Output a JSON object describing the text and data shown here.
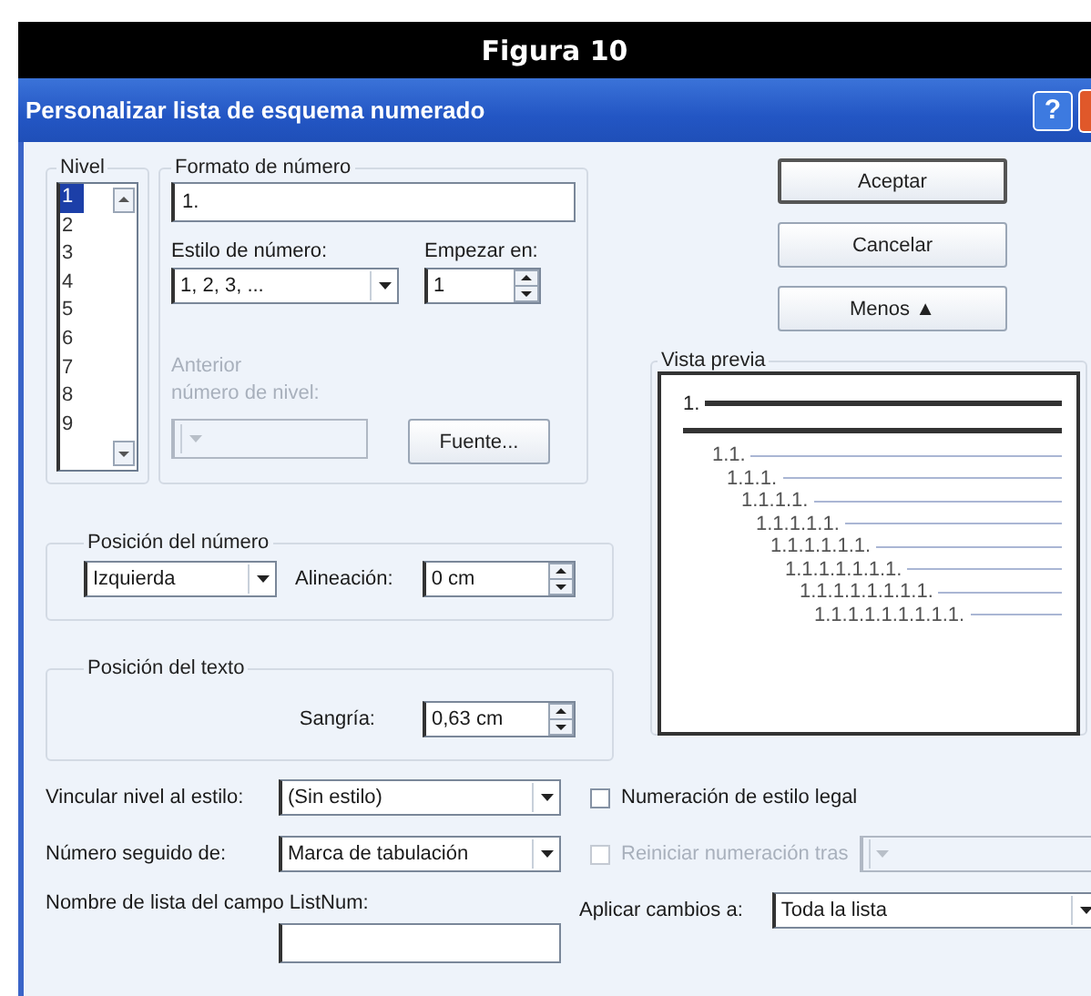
{
  "figure_caption": "Figura 10",
  "window": {
    "title": "Personalizar lista de esquema numerado",
    "help_button": "?"
  },
  "level": {
    "label": "Nivel",
    "items": [
      {
        "label": "1",
        "selected": true
      },
      {
        "label": "2",
        "selected": false
      },
      {
        "label": "3",
        "selected": false
      },
      {
        "label": "4",
        "selected": false
      },
      {
        "label": "5",
        "selected": false
      },
      {
        "label": "6",
        "selected": false
      },
      {
        "label": "7",
        "selected": false
      },
      {
        "label": "8",
        "selected": false
      },
      {
        "label": "9",
        "selected": false
      }
    ]
  },
  "number_format": {
    "label": "Formato de número",
    "value": "1.",
    "style_label": "Estilo de número:",
    "style_value": "1, 2, 3, ...",
    "start_label": "Empezar en:",
    "start_value": "1",
    "previous_label_1": "Anterior",
    "previous_label_2": "número de nivel:",
    "previous_disabled": true,
    "font_button": "Fuente..."
  },
  "buttons": [
    {
      "label": "Aceptar",
      "default": true
    },
    {
      "label": "Cancelar",
      "default": false
    },
    {
      "label": "Menos ▲",
      "default": false
    }
  ],
  "preview": {
    "label": "Vista previa",
    "lines": [
      {
        "kind": "main",
        "label": "1."
      },
      {
        "kind": "continuation"
      },
      {
        "kind": "sub",
        "label": "1.1."
      },
      {
        "kind": "sub",
        "label": "1.1.1."
      },
      {
        "kind": "sub",
        "label": "1.1.1.1."
      },
      {
        "kind": "sub",
        "label": "1.1.1.1.1."
      },
      {
        "kind": "sub",
        "label": "1.1.1.1.1.1."
      },
      {
        "kind": "sub",
        "label": "1.1.1.1.1.1.1."
      },
      {
        "kind": "sub",
        "label": "1.1.1.1.1.1.1.1."
      },
      {
        "kind": "sub",
        "label": "1.1.1.1.1.1.1.1.1."
      }
    ]
  },
  "number_position": {
    "label": "Posición del número",
    "alignment_value": "Izquierda",
    "offset_label": "Alineación:",
    "offset_value": "0 cm"
  },
  "text_position": {
    "label": "Posición del texto",
    "indent_label": "Sangría:",
    "indent_value": "0,63 cm"
  },
  "link_level": {
    "label": "Vincular nivel al estilo:",
    "value": "(Sin estilo)"
  },
  "legal_numbering": {
    "label": "Numeración de estilo legal",
    "checked": false,
    "disabled": false
  },
  "follow_number": {
    "label": "Número seguido de:",
    "value": "Marca de tabulación"
  },
  "restart_numbering": {
    "label": "Reiniciar numeración tras",
    "checked": false,
    "disabled": true
  },
  "listnum_name": {
    "label": "Nombre de lista del campo ListNum:"
  },
  "apply_to": {
    "label": "Aplicar cambios a:",
    "value": "Toda la lista"
  }
}
